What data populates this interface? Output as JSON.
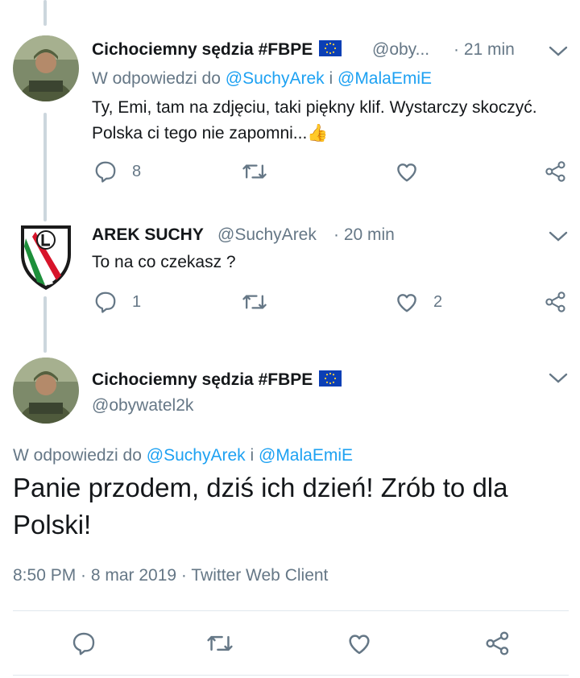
{
  "tweet1": {
    "name": "Cichociemny sędzia #FBPE",
    "handle": "@oby...",
    "time": "· 21 min",
    "reply_prefix": "W odpowiedzi do",
    "reply_user1": "@SuchyArek",
    "reply_and": "i",
    "reply_user2": "@MalaEmiE",
    "text": "Ty, Emi, tam na zdjęciu, taki piękny klif. Wystarczy skoczyć. Polska ci tego nie zapomni...",
    "emoji": "👍",
    "reply_count": "8"
  },
  "tweet2": {
    "name": "AREK SUCHY",
    "handle": "@SuchyArek",
    "time": "· 20 min",
    "text": "To na co czekasz ?",
    "reply_count": "1",
    "like_count": "2"
  },
  "main_tweet": {
    "name": "Cichociemny sędzia #FBPE",
    "handle": "@obywatel2k",
    "reply_prefix": "W odpowiedzi do",
    "reply_user1": "@SuchyArek",
    "reply_and": "i",
    "reply_user2": "@MalaEmiE",
    "text": "Panie przodem, dziś ich dzień! Zrób to dla Polski!",
    "meta": "8:50 PM · 8 mar 2019 · Twitter Web Client"
  },
  "icons": {
    "reply": "reply-icon",
    "retweet": "retweet-icon",
    "like": "heart-icon",
    "share": "share-icon",
    "more": "chevron-down-icon",
    "flag": "eu-flag-icon"
  },
  "colors": {
    "link": "#1da1f2",
    "secondary_text": "#657786",
    "icon": "#657786",
    "thread_line": "#ccd6dd"
  }
}
